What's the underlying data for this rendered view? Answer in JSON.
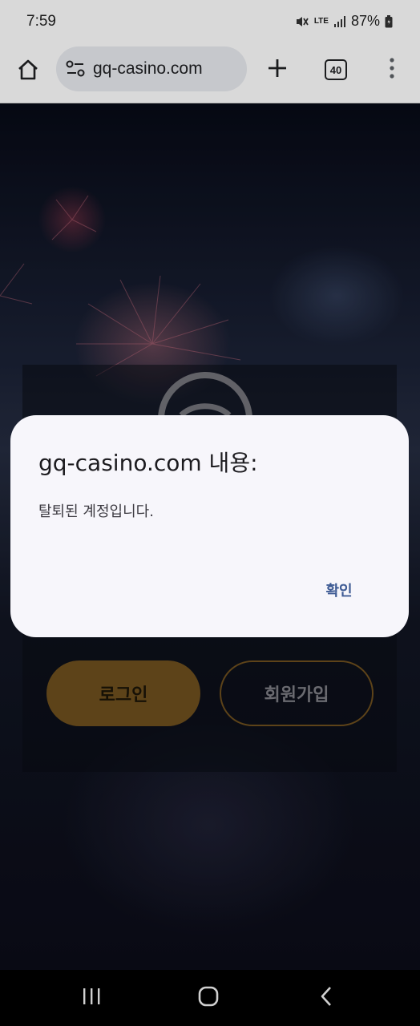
{
  "status_bar": {
    "time": "7:59",
    "network": "LTE",
    "battery": "87%"
  },
  "browser": {
    "url": "gq-casino.com",
    "tab_count": "40",
    "icons": [
      "home-icon",
      "site-settings-icon",
      "plus-icon",
      "tab-switcher-icon",
      "more-vert-icon"
    ]
  },
  "page": {
    "login_label": "로그인",
    "signup_label": "회원가입",
    "accent_color": "#6e4f1e"
  },
  "dialog": {
    "title": "gq-casino.com 내용:",
    "message": "탈퇴된 계정입니다.",
    "ok_label": "확인",
    "ok_color": "#3e5b94"
  },
  "nav": {
    "icons": [
      "recent-apps-icon",
      "home-circle-icon",
      "back-icon"
    ]
  }
}
